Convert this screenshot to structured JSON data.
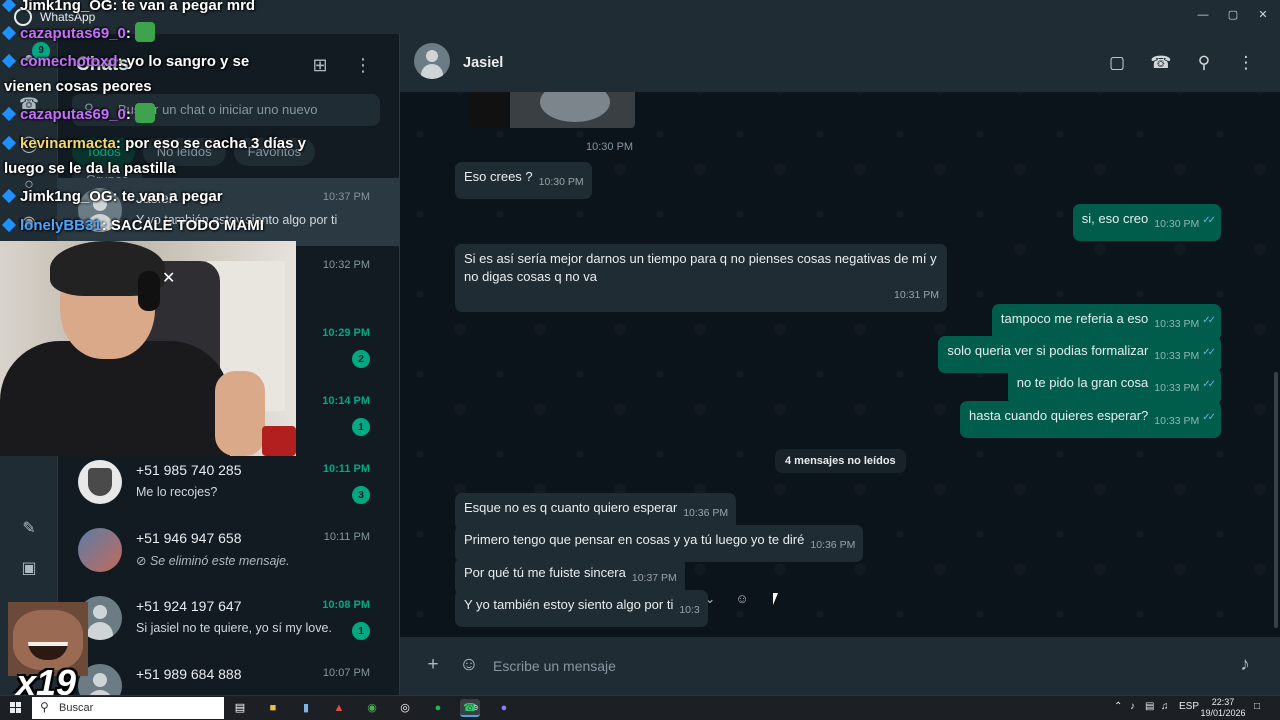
{
  "window": {
    "title": "WhatsApp",
    "rail_badge": "9"
  },
  "sidebar": {
    "title": "Chats",
    "search_placeholder": "Buscar un chat o iniciar uno nuevo",
    "filters": [
      "Todos",
      "No leídos",
      "Favoritos",
      "Grupos"
    ],
    "chats": [
      {
        "name": "Jasiel",
        "preview": "Y yo también estoy siento algo por ti",
        "time": "10:37 PM",
        "unread": "",
        "avatar": "default",
        "deleted": false
      },
      {
        "name": "",
        "preview": "",
        "time": "10:32 PM",
        "unread": "",
        "avatar": "default",
        "deleted": false
      },
      {
        "name": "",
        "preview": "",
        "time": "10:29 PM",
        "unread": "2",
        "avatar": "default",
        "deleted": false
      },
      {
        "name": "",
        "preview": "",
        "time": "10:14 PM",
        "unread": "1",
        "avatar": "default",
        "deleted": false
      },
      {
        "name": "+51 985 740 285",
        "preview": "Me lo recojes?",
        "time": "10:11 PM",
        "unread": "3",
        "avatar": "crest",
        "deleted": false
      },
      {
        "name": "+51 946 947 658",
        "preview": "Se eliminó este mensaje.",
        "time": "10:11 PM",
        "unread": "",
        "avatar": "photo",
        "deleted": true
      },
      {
        "name": "+51 924 197 647",
        "preview": "Si jasiel no te quiere, yo sí my love.",
        "time": "10:08 PM",
        "unread": "1",
        "avatar": "default",
        "deleted": false
      },
      {
        "name": "+51 989 684 888",
        "preview": "",
        "time": "10:07 PM",
        "unread": "",
        "avatar": "default",
        "deleted": false
      }
    ]
  },
  "conversation": {
    "contact_name": "Jasiel",
    "image_time": "10:30 PM",
    "messages": [
      {
        "dir": "in",
        "text": "Eso crees ?",
        "time": "10:30 PM",
        "read": false
      },
      {
        "dir": "out",
        "text": "si, eso creo",
        "time": "10:30 PM",
        "read": true
      },
      {
        "dir": "in",
        "text": "Si es así sería mejor darnos un tiempo para q no pienses cosas negativas de mí y no digas cosas q no va",
        "time": "10:31 PM",
        "read": false
      },
      {
        "dir": "out",
        "text": "tampoco me referia a eso",
        "time": "10:33 PM",
        "read": true
      },
      {
        "dir": "out",
        "text": "solo queria ver si podias formalizar",
        "time": "10:33 PM",
        "read": true
      },
      {
        "dir": "out",
        "text": "no te pido la gran cosa",
        "time": "10:33 PM",
        "read": true
      },
      {
        "dir": "out",
        "text": "hasta cuando quieres esperar?",
        "time": "10:33 PM",
        "read": true
      },
      {
        "dir": "in",
        "text": "Esque no es q cuanto quiero esperar",
        "time": "10:36 PM",
        "read": false
      },
      {
        "dir": "in",
        "text": "Primero tengo que pensar en cosas y ya tú luego yo te diré",
        "time": "10:36 PM",
        "read": false
      },
      {
        "dir": "in",
        "text": "Por qué tú me fuiste sincera",
        "time": "10:37 PM",
        "read": false
      },
      {
        "dir": "in",
        "text": "Y yo también estoy siento algo por ti",
        "time": "10:3",
        "read": false
      }
    ],
    "unread_divider": "4 mensajes no leídos",
    "composer_placeholder": "Escribe un mensaje"
  },
  "stream_chat": [
    {
      "user": "Jimk1ng_OG",
      "text": ": te van a pegar mrd",
      "color": "#ffffff"
    },
    {
      "user": "cazaputas69_0",
      "text": ":",
      "color": "#c770ff"
    },
    {
      "user": "comechotoxd",
      "text": ": yo lo sangro y se",
      "color": "#c770ff"
    },
    {
      "user": "",
      "text": "vienen cosas peores",
      "color": "#ffffff"
    },
    {
      "user": "cazaputas69_0",
      "text": ":",
      "color": "#c770ff"
    },
    {
      "user": "kevinarmacta",
      "text": ": por eso se cacha 3 días y",
      "color": "#f5d76e"
    },
    {
      "user": "",
      "text": "luego se le da la pastilla",
      "color": "#ffffff"
    },
    {
      "user": "Jimk1ng_OG",
      "text": ": te van a pegar",
      "color": "#ffffff"
    },
    {
      "user": "lonelyBB31",
      "text": ": SACALE TODO MAMI",
      "color": "#4da6ff"
    }
  ],
  "meme_label": "x19",
  "taskbar": {
    "search_placeholder": "Buscar",
    "language": "ESP",
    "time": "22:37",
    "date": "19/01/2026",
    "whatsapp_badge": "9"
  }
}
